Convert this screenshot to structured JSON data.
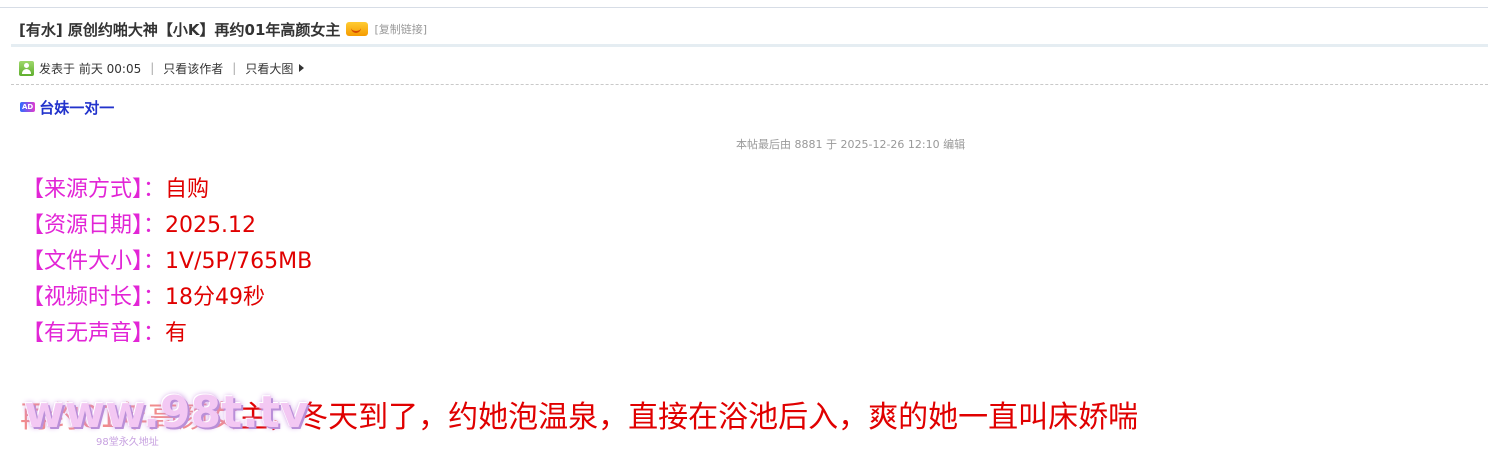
{
  "thread": {
    "title": "[有水] 原创约啪大神【小K】再约01年高颜女主",
    "copy_link": "[复制链接]"
  },
  "author_bar": {
    "posted": "发表于 前天 00:05",
    "separator": "|",
    "only_author": "只看该作者",
    "big_images": "只看大图"
  },
  "ad": {
    "badge": "AD",
    "link": "台妹一对一"
  },
  "edit_note": "本帖最后由 8881 于 2025-12-26 12:10 编辑",
  "info": [
    {
      "label": "【来源方式】：",
      "value": "自购"
    },
    {
      "label": "【资源日期】：",
      "value": "2025.12"
    },
    {
      "label": "【文件大小】：",
      "value": "1V/5P/765MB"
    },
    {
      "label": "【视频时长】：",
      "value": "18分49秒"
    },
    {
      "label": "【有无声音】：",
      "value": "有"
    }
  ],
  "description": "再约01年高颜女主，冬天到了，约她泡温泉，直接在浴池后入，爽的她一直叫床娇喘",
  "watermark": {
    "text": "www.98t.tv",
    "sub": "98堂永久地址"
  },
  "colors": {
    "label": "#e225d6",
    "value": "#e00000",
    "ad_link": "#2233cc"
  },
  "icons": [
    "hot-icon",
    "user-icon",
    "arrow-right-icon",
    "ad-icon"
  ]
}
